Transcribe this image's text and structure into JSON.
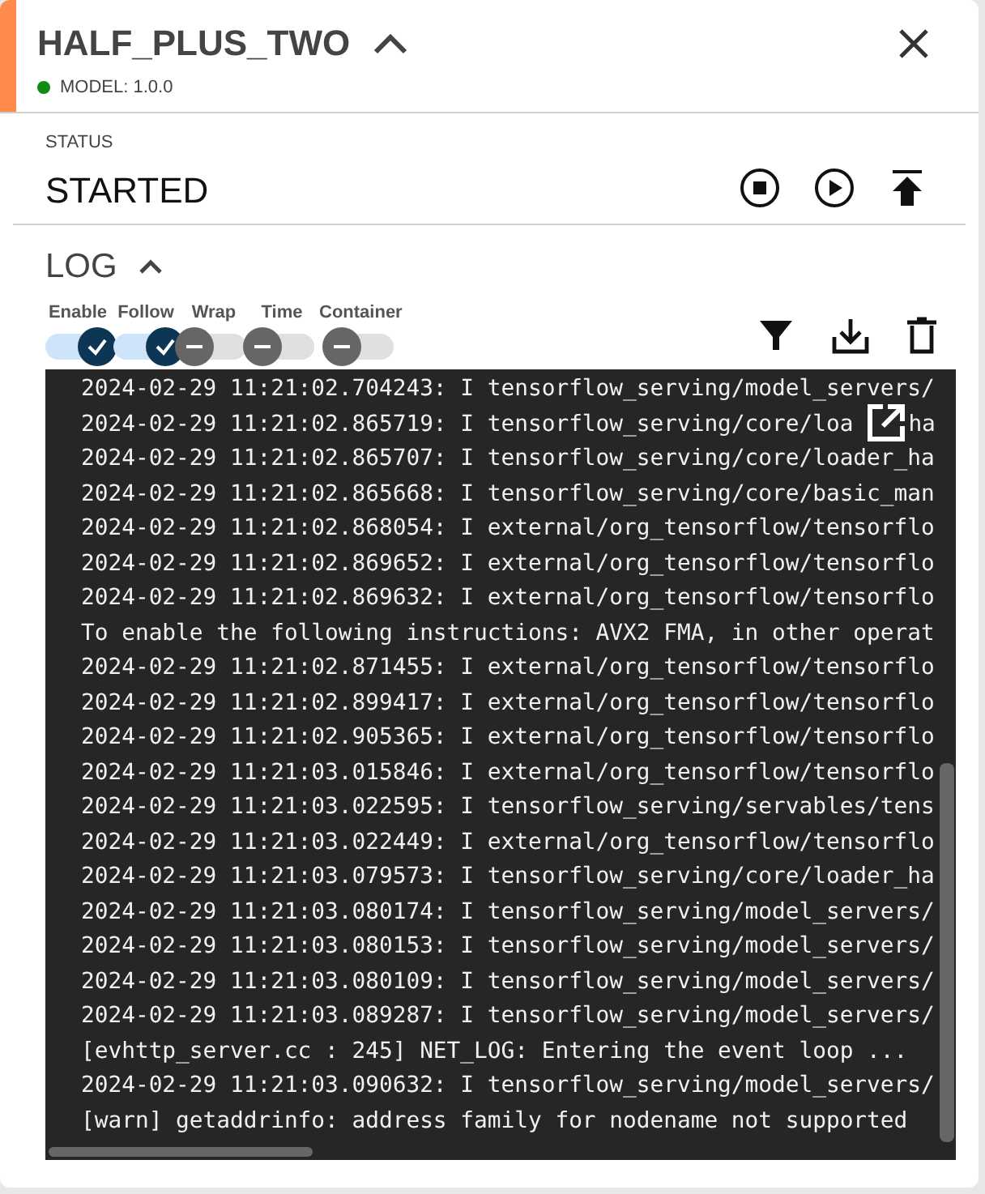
{
  "header": {
    "title": "HALF_PLUS_TWO",
    "model": "MODEL: 1.0.0"
  },
  "status": {
    "label": "STATUS",
    "value": "STARTED"
  },
  "log": {
    "title": "LOG",
    "toggles": [
      {
        "label": "Enable",
        "checked": true
      },
      {
        "label": "Follow",
        "checked": true
      },
      {
        "label": "Wrap",
        "checked": false
      },
      {
        "label": "Time",
        "checked": false
      },
      {
        "label": "Container",
        "checked": false
      }
    ],
    "lines": [
      "2024-02-29 11:21:02.704243: I tensorflow_serving/model_servers/",
      {
        "text": "2024-02-29 11:21:02.865719: I tensorflow_serving/core/loa",
        "after_icon": "ha"
      },
      "2024-02-29 11:21:02.865707: I tensorflow_serving/core/loader_ha",
      "2024-02-29 11:21:02.865668: I tensorflow_serving/core/basic_man",
      "2024-02-29 11:21:02.868054: I external/org_tensorflow/tensorflo",
      "2024-02-29 11:21:02.869652: I external/org_tensorflow/tensorflo",
      "2024-02-29 11:21:02.869632: I external/org_tensorflow/tensorflo",
      "To enable the following instructions: AVX2 FMA, in other operat",
      "2024-02-29 11:21:02.871455: I external/org_tensorflow/tensorflo",
      "2024-02-29 11:21:02.899417: I external/org_tensorflow/tensorflo",
      "2024-02-29 11:21:02.905365: I external/org_tensorflow/tensorflo",
      "2024-02-29 11:21:03.015846: I external/org_tensorflow/tensorflo",
      "2024-02-29 11:21:03.022595: I tensorflow_serving/servables/tens",
      "2024-02-29 11:21:03.022449: I external/org_tensorflow/tensorflo",
      "2024-02-29 11:21:03.079573: I tensorflow_serving/core/loader_ha",
      "2024-02-29 11:21:03.080174: I tensorflow_serving/model_servers/",
      "2024-02-29 11:21:03.080153: I tensorflow_serving/model_servers/",
      "2024-02-29 11:21:03.080109: I tensorflow_serving/model_servers/",
      "2024-02-29 11:21:03.089287: I tensorflow_serving/model_servers/",
      "[evhttp_server.cc : 245] NET_LOG: Entering the event loop ...",
      "2024-02-29 11:21:03.090632: I tensorflow_serving/model_servers/",
      "[warn] getaddrinfo: address family for nodename not supported"
    ]
  }
}
